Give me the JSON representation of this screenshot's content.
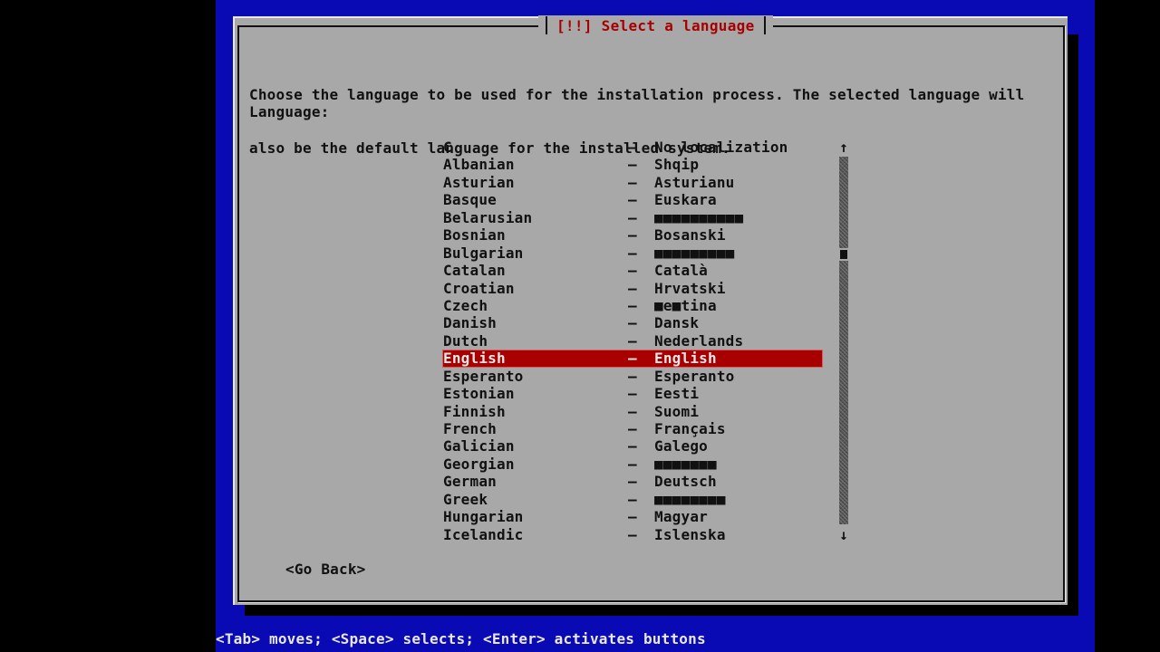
{
  "dialog": {
    "title": "[!!] Select a language",
    "description_line1": "Choose the language to be used for the installation process. The selected language will",
    "description_line2": "also be the default language for the installed system.",
    "field_label": "Language:"
  },
  "languages": [
    {
      "name": "C",
      "native": "No localization"
    },
    {
      "name": "Albanian",
      "native": "Shqip"
    },
    {
      "name": "Asturian",
      "native": "Asturianu"
    },
    {
      "name": "Basque",
      "native": "Euskara"
    },
    {
      "name": "Belarusian",
      "native": "■■■■■■■■■■"
    },
    {
      "name": "Bosnian",
      "native": "Bosanski"
    },
    {
      "name": "Bulgarian",
      "native": "■■■■■■■■■"
    },
    {
      "name": "Catalan",
      "native": "Català"
    },
    {
      "name": "Croatian",
      "native": "Hrvatski"
    },
    {
      "name": "Czech",
      "native": "■e■tina"
    },
    {
      "name": "Danish",
      "native": "Dansk"
    },
    {
      "name": "Dutch",
      "native": "Nederlands"
    },
    {
      "name": "English",
      "native": "English",
      "selected": true
    },
    {
      "name": "Esperanto",
      "native": "Esperanto"
    },
    {
      "name": "Estonian",
      "native": "Eesti"
    },
    {
      "name": "Finnish",
      "native": "Suomi"
    },
    {
      "name": "French",
      "native": "Français"
    },
    {
      "name": "Galician",
      "native": "Galego"
    },
    {
      "name": "Georgian",
      "native": "■■■■■■■"
    },
    {
      "name": "German",
      "native": "Deutsch"
    },
    {
      "name": "Greek",
      "native": "■■■■■■■■"
    },
    {
      "name": "Hungarian",
      "native": "Magyar"
    },
    {
      "name": "Icelandic",
      "native": "Islenska"
    }
  ],
  "separator": "–",
  "selected_language": "English",
  "scrollbar": {
    "up_arrow": "↑",
    "down_arrow": "↓",
    "position_fraction": 0.26
  },
  "buttons": {
    "go_back": "<Go Back>"
  },
  "help_text": "<Tab> moves; <Space> selects; <Enter> activates buttons",
  "colors": {
    "background": "#0a0ab4",
    "dialog": "#a8a8a8",
    "title": "#a80000",
    "selection": "#a80000"
  }
}
